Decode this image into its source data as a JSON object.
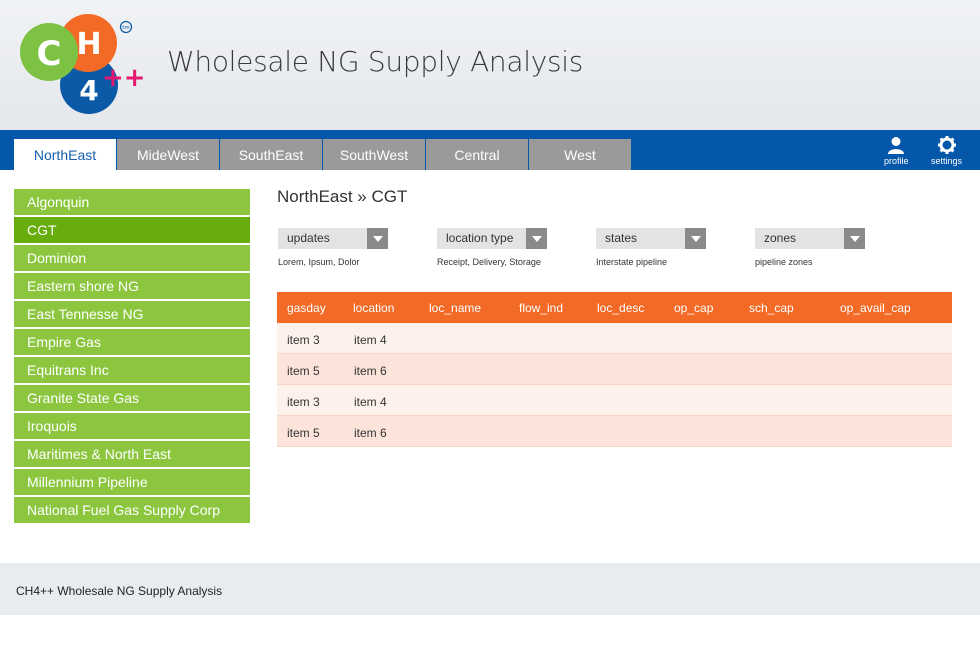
{
  "app": {
    "title": "Wholesale NG Supply Analysis",
    "logo": {
      "letter_c": "C",
      "letter_h": "H",
      "digit_4": "4",
      "plus": "++",
      "trademark": "tm"
    }
  },
  "nav": {
    "tabs": [
      "NorthEast",
      "MideWest",
      "SouthEast",
      "SouthWest",
      "Central",
      "West"
    ],
    "active_tab": "NorthEast",
    "profile_label": "profile",
    "settings_label": "settings"
  },
  "sidebar": {
    "items": [
      "Algonquin",
      "CGT",
      "Dominion",
      "Eastern shore NG",
      "East Tennesse NG",
      "Empire Gas",
      "Equitrans Inc",
      "Granite State Gas",
      "Iroquois",
      "Maritimes & North East",
      "Millennium Pipeline",
      "National Fuel Gas Supply Corp"
    ],
    "active_item": "CGT"
  },
  "breadcrumb": "NorthEast » CGT",
  "filters": [
    {
      "label": "updates",
      "description": "Lorem, Ipsum, Dolor"
    },
    {
      "label": "location type",
      "description": "Receipt, Delivery, Storage"
    },
    {
      "label": "states",
      "description": "Interstate pipeline"
    },
    {
      "label": "zones",
      "description": "pipeline zones"
    }
  ],
  "table": {
    "columns": [
      "gasday",
      "location",
      "loc_name",
      "flow_ind",
      "loc_desc",
      "op_cap",
      "sch_cap",
      "op_avail_cap"
    ],
    "rows": [
      [
        "item 3",
        "item 4",
        "",
        "",
        "",
        "",
        "",
        ""
      ],
      [
        "item 5",
        "item 6",
        "",
        "",
        "",
        "",
        "",
        ""
      ],
      [
        "item 3",
        "item 4",
        "",
        "",
        "",
        "",
        "",
        ""
      ],
      [
        "item 5",
        "item 6",
        "",
        "",
        "",
        "",
        "",
        ""
      ]
    ]
  },
  "footer": {
    "text": "CH4++ Wholesale NG Supply Analysis"
  },
  "colors": {
    "nav_blue": "#0557a9",
    "sidebar_green": "#8cc63f",
    "sidebar_active": "#67ad0c",
    "table_header": "#f26a26",
    "logo_green": "#7dc242",
    "logo_orange": "#f26a26",
    "logo_blue": "#0b59a7",
    "logo_plus": "#e5186f"
  }
}
